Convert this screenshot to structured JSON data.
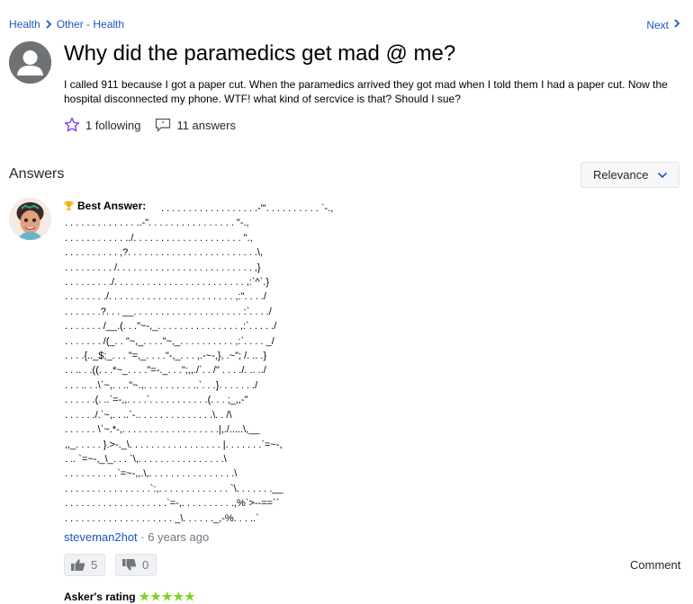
{
  "breadcrumb": {
    "items": [
      "Health",
      "Other - Health"
    ],
    "next_label": "Next"
  },
  "question": {
    "title": "Why did the paramedics get mad @ me?",
    "body": "I called 911 because I got a paper cut. When the paramedics arrived they got mad when I told them I had a paper cut. Now the hospital disconnected my phone. WTF! what kind of sercvice is that? Should I sue?",
    "following": "1 following",
    "answers": "11 answers"
  },
  "answers_section": {
    "heading": "Answers",
    "sort_label": "Relevance"
  },
  "best_answer": {
    "label": "Best Answer:",
    "art": " . . . . . . . . . . . . . . . . . .-'\". . . . . . . . . . `-.,\n. . . . . . . . . . . . . ..-\". . . . . . . . . . . . . . . . \"-.,\n. . . . . . . . . . . ../. . . . . . . . . . . . . . . . . . . . \".,\n. . . . . . . . . . ,?. . . . . . . . . . . . . . . . . . . . . . . .\\,\n. . . . . . . . . /. . . . . . . . . . . . . . . . . . . . . . . . . ,}\n. . . . . . . . ./. . . . . . . . . . . . . . . . . . . . . . . . ,:`^`.}\n. . . . . . . ./. . . . . . . . . . . . . . . . . . . . . . . ,:\". . . ./\n. . . . . . .?. . . __. . . . . . . . . . . . . . . . . . . . :`. . . ./\n. . . . . . . /__.(. . .\"~-,_. . . . . . . . . . . . . . . ,:`. . . . ./\n. . . . . . . /(_. . \"~,_. . . .\"~,_. . . . . . . . . . ,:`. . . . _/\n. . . .{.._$;_. . . \"=,_. . . .\"-,_. . . ,.-~-,}, .~\"; /. .. .}\n. . .. . .((. . .*~_. . . .\"=-._. . .\";,,./`. . /\" . . . ./. .. ../\n. . . .. . .\\`~,. . ..\"~.,. . . . . . . . . ..`. . .}. . . . . . ./\n. . . . . .(. ..`=-,,. . . .`. . . . . . . . . . .(. . . ;_,,-\"\n. . . . . ./.`~,. . ..`-.. . . . . . . . . . . . . .\\. . /\\\n. . . . . . \\`~.*-,. . . . . . . . . . . . . . . . . .|,./.....\\,__\n,,_. . . . . }.>-._\\. . . . . . . . . . . . . . . . . |. . . . . . .`=~-,\n. .. `=~-,_\\_. . . `\\,. . . . . . . . . . . . . . . .\\\n. . . . . . . . . .`=~-,,.\\,. . . . . . . . . . . . . . . .\\\n. . . . . . . . . . . . . . . .`:,. . . . . . . . . . . . . `\\. . . . . . .__\n. . . . . . . . . . . . . . . . . . .`=-,. . . . . . . . . .,%`>--==``\n. . . . . . . . . . . . . . . . . . . . _\\. . . . . ._,-%. . . ..`"
  },
  "answerer": {
    "name": "steveman2hot",
    "separator": "·",
    "time_ago": "6 years ago"
  },
  "votes": {
    "up": "5",
    "down": "0"
  },
  "comment_label": "Comment",
  "askers_rating": {
    "label": "Asker's rating",
    "stars": "★★★★★"
  },
  "colors": {
    "link": "#1a56c4",
    "star_outline": "#7f34e8",
    "rating_green": "#7ed321"
  },
  "icons": [
    "chevron-right-icon",
    "user-silhouette-icon",
    "star-outline-icon",
    "speech-bubble-icon",
    "chevron-down-icon",
    "trophy-icon",
    "thumbs-up-icon",
    "thumbs-down-icon"
  ]
}
